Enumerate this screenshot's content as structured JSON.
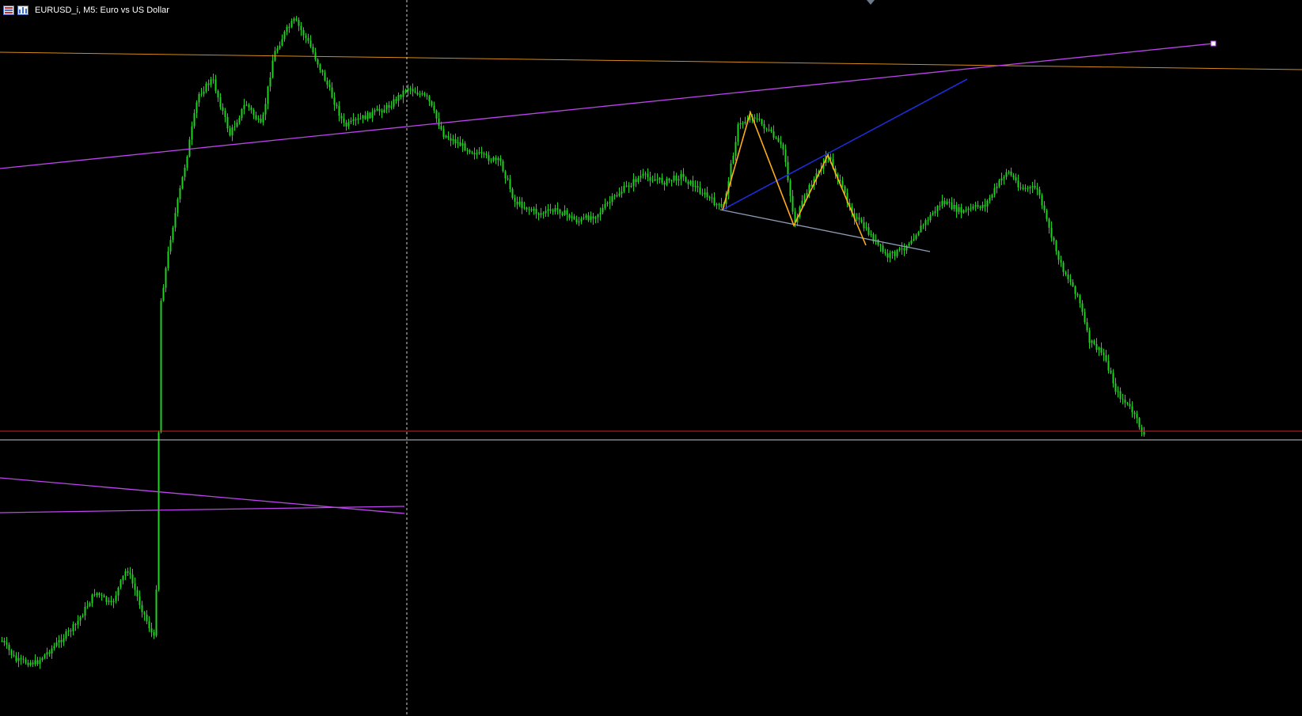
{
  "window": {
    "title": "EURUSD_i, M5:  Euro vs US Dollar",
    "icons": [
      "chart-type-icon",
      "bar-chart-icon"
    ]
  },
  "chart_data": {
    "type": "candlestick",
    "symbol": "EURUSD_i",
    "timeframe": "M5",
    "description": "Euro vs US Dollar",
    "grid": false,
    "legend": "none",
    "colors": {
      "background": "#000000",
      "candle": "#1fd21f",
      "trendline_purple": "#c043f0",
      "resistance_orange": "#d58a17",
      "support_red": "#d41f1f",
      "level_gray": "#c6c6c6",
      "channel_blue": "#1f2bd8",
      "zigzag_orange": "#ffad17",
      "neckline_gray": "#8e9bb3",
      "crosshair": "#d0d0d0"
    },
    "drawings": [
      "trendline",
      "trendline",
      "horizontal-line",
      "horizontal-line",
      "trendline",
      "trendline",
      "trendline",
      "zigzag",
      "trendline",
      "vertical-crosshair"
    ]
  }
}
